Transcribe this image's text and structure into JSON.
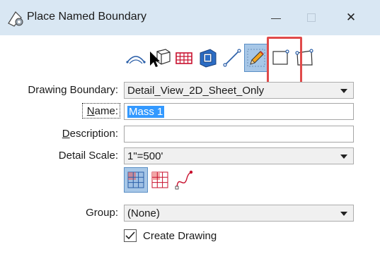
{
  "window": {
    "title": "Place Named Boundary",
    "minimize": "—",
    "close": "✕"
  },
  "form": {
    "drawing_boundary": {
      "label": "Drawing Boundary:",
      "value": "Detail_View_2D_Sheet_Only"
    },
    "name": {
      "label_underline": "N",
      "label_rest": "ame:",
      "value": "Mass 1"
    },
    "description": {
      "label_underline": "D",
      "label_rest": "escription:",
      "value": ""
    },
    "detail_scale": {
      "label": "Detail Scale:",
      "value": "1\"=500'"
    },
    "group": {
      "label": "Group:",
      "value": "(None)"
    },
    "create_drawing": {
      "label": "Create Drawing",
      "checked": true
    }
  },
  "colors": {
    "titlebar": "#d9e7f3",
    "selected": "#a7c7e7",
    "selection_text_bg": "#3399ff",
    "highlight": "#e04a4a"
  }
}
